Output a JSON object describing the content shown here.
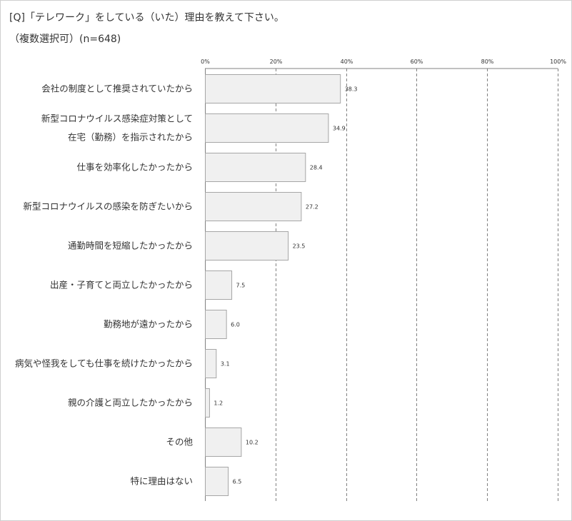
{
  "question": "[Q]「テレワーク」をしている（いた）理由を教えて下さい。",
  "note": "（複数選択可）(n=648)",
  "chart_data": {
    "type": "bar",
    "orientation": "horizontal",
    "title": "[Q]「テレワーク」をしている（いた）理由を教えて下さい。",
    "subtitle": "（複数選択可）(n=648)",
    "categories": [
      [
        "会社の制度として推奨されていたから"
      ],
      [
        "新型コロナウイルス感染症対策として",
        "在宅（勤務）を指示されたから"
      ],
      [
        "仕事を効率化したかったから"
      ],
      [
        "新型コロナウイルスの感染を防ぎたいから"
      ],
      [
        "通勤時間を短縮したかったから"
      ],
      [
        "出産・子育てと両立したかったから"
      ],
      [
        "勤務地が遠かったから"
      ],
      [
        "病気や怪我をしても仕事を続けたかったから"
      ],
      [
        "親の介護と両立したかったから"
      ],
      [
        "その他"
      ],
      [
        "特に理由はない"
      ]
    ],
    "values": [
      38.3,
      34.9,
      28.4,
      27.2,
      23.5,
      7.5,
      6.0,
      3.1,
      1.2,
      10.2,
      6.5
    ],
    "value_labels": [
      "38.3",
      "34.9",
      "28.4",
      "27.2",
      "23.5",
      "7.5",
      "6.0",
      "3.1",
      "1.2",
      "10.2",
      "6.5"
    ],
    "xlim": [
      0,
      100
    ],
    "x_ticks": [
      0,
      20,
      40,
      60,
      80,
      100
    ],
    "x_tick_labels": [
      "0%",
      "20%",
      "40%",
      "60%",
      "80%",
      "100%"
    ],
    "xlabel": "",
    "ylabel": "",
    "grid": true,
    "bar_fill": "#f0f0f0",
    "bar_stroke": "#a6a6a6",
    "grid_color": "#808080"
  }
}
